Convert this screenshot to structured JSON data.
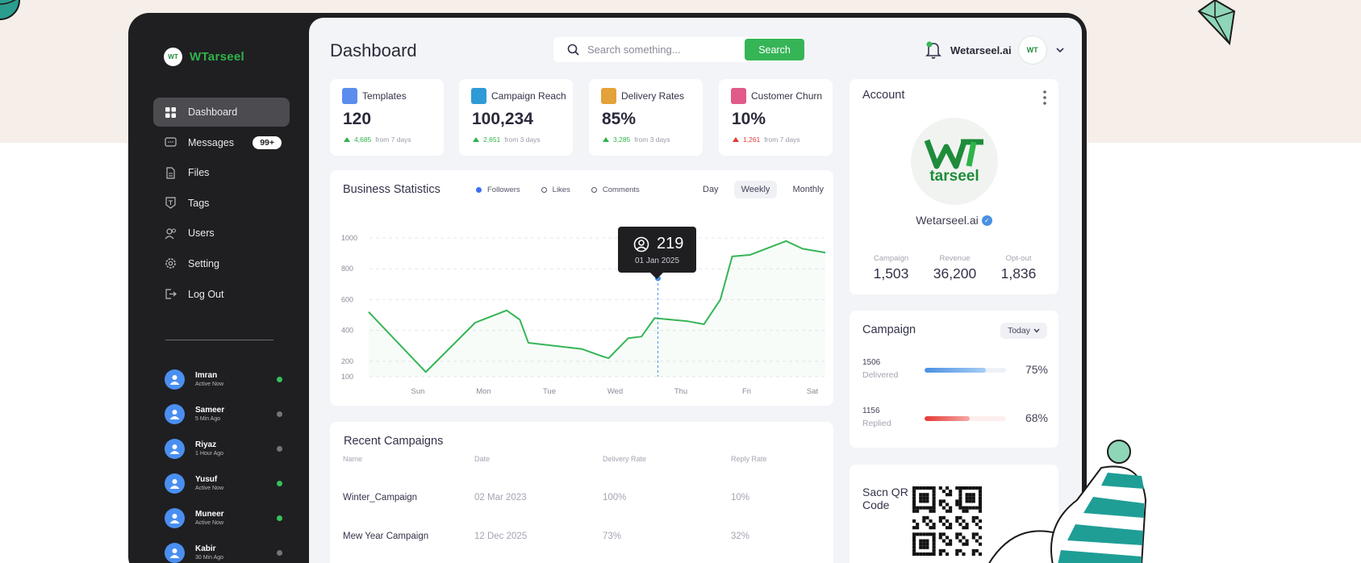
{
  "brand": {
    "name": "WTarseel",
    "badge": "WT"
  },
  "nav": [
    {
      "label": "Dashboard",
      "icon": "grid-icon",
      "active": true
    },
    {
      "label": "Messages",
      "icon": "message-icon",
      "badge": "99+"
    },
    {
      "label": "Files",
      "icon": "file-icon"
    },
    {
      "label": "Tags",
      "icon": "tag-icon"
    },
    {
      "label": "Users",
      "icon": "users-icon"
    },
    {
      "label": "Setting",
      "icon": "gear-icon"
    },
    {
      "label": "Log Out",
      "icon": "logout-icon"
    }
  ],
  "users": [
    {
      "name": "Imran",
      "status": "Active Now",
      "online": true
    },
    {
      "name": "Sameer",
      "status": "5 Min Ago",
      "online": false
    },
    {
      "name": "Riyaz",
      "status": "1 Hour Ago",
      "online": false
    },
    {
      "name": "Yusuf",
      "status": "Active Now",
      "online": true
    },
    {
      "name": "Muneer",
      "status": "Active Now",
      "online": true
    },
    {
      "name": "Kabir",
      "status": "30 Min Ago",
      "online": false
    }
  ],
  "header": {
    "title": "Dashboard",
    "search_placeholder": "Search something...",
    "search_button": "Search",
    "org_name": "Wetarseel.ai",
    "org_badge": "WT"
  },
  "stats": [
    {
      "label": "Templates",
      "value": "120",
      "delta": "4,685",
      "period": "from 7 days",
      "direction": "up",
      "icon": "templates-icon",
      "color": "#5b8def"
    },
    {
      "label": "Campaign Reach",
      "value": "100,234",
      "delta": "2,651",
      "period": "from 3 days",
      "direction": "up",
      "icon": "megaphone-icon",
      "color": "#2e9bd6"
    },
    {
      "label": "Delivery Rates",
      "value": "85%",
      "delta": "3,285",
      "period": "from 3 days",
      "direction": "up",
      "icon": "package-icon",
      "color": "#e3a23a"
    },
    {
      "label": "Customer Churn",
      "value": "10%",
      "delta": "1,261",
      "period": "from 7 days",
      "direction": "down",
      "icon": "people-icon",
      "color": "#e05a8a"
    }
  ],
  "business": {
    "title": "Business Statistics",
    "legend": [
      {
        "label": "Followers",
        "filled": true
      },
      {
        "label": "Likes",
        "filled": false
      },
      {
        "label": "Comments",
        "filled": false
      }
    ],
    "periods": [
      {
        "label": "Day",
        "active": false
      },
      {
        "label": "Weekly",
        "active": true
      },
      {
        "label": "Monthly",
        "active": false
      }
    ],
    "tooltip": {
      "value": "219",
      "date": "01 Jan 2025"
    }
  },
  "chart_data": {
    "type": "line",
    "title": "Business Statistics",
    "x_ticks": [
      "Sun",
      "Mon",
      "Tue",
      "Wed",
      "Thu",
      "Fri",
      "Sat"
    ],
    "y_ticks": [
      100,
      200,
      400,
      600,
      800,
      1000
    ],
    "ylim": [
      100,
      1000
    ],
    "grid": true,
    "series": [
      {
        "name": "Followers",
        "color": "#36b557",
        "x": [
          -0.75,
          0.12,
          0.87,
          1.35,
          1.55,
          1.68,
          2.49,
          2.82,
          2.9,
          3.2,
          3.4,
          3.6,
          4.1,
          4.35,
          4.6,
          4.78,
          5.05,
          5.6,
          5.85,
          6.4
        ],
        "y": [
          520,
          130,
          450,
          530,
          470,
          320,
          280,
          230,
          220,
          350,
          360,
          480,
          460,
          440,
          600,
          880,
          890,
          980,
          930,
          890
        ]
      }
    ],
    "highlight": {
      "x": 3.65,
      "label": "219",
      "date": "01 Jan 2025"
    }
  },
  "recent": {
    "title": "Recent Campaigns",
    "columns": [
      "Name",
      "Date",
      "Delivery Rate",
      "Reply Rate"
    ],
    "rows": [
      [
        "Winter_Campaign",
        "02 Mar 2023",
        "100%",
        "10%"
      ],
      [
        "Mew Year Campaign",
        "12 Dec 2025",
        "73%",
        "32%"
      ]
    ]
  },
  "account": {
    "title": "Account",
    "logo_text": "tarseel",
    "name": "Wetarseel.ai",
    "stats": [
      {
        "label": "Campaign",
        "value": "1,503"
      },
      {
        "label": "Revenue",
        "value": "36,200"
      },
      {
        "label": "Opt-out",
        "value": "1,836"
      }
    ]
  },
  "campaign": {
    "title": "Campaign",
    "filter": "Today",
    "rows": [
      {
        "count": "1506",
        "label": "Delivered",
        "percent": "75%",
        "fill": 0.75,
        "color": "#4a90e2"
      },
      {
        "count": "1156",
        "label": "Replied",
        "percent": "68%",
        "fill": 0.55,
        "color": "#e53935"
      }
    ]
  },
  "qr": {
    "label": "Sacn QR Code"
  }
}
